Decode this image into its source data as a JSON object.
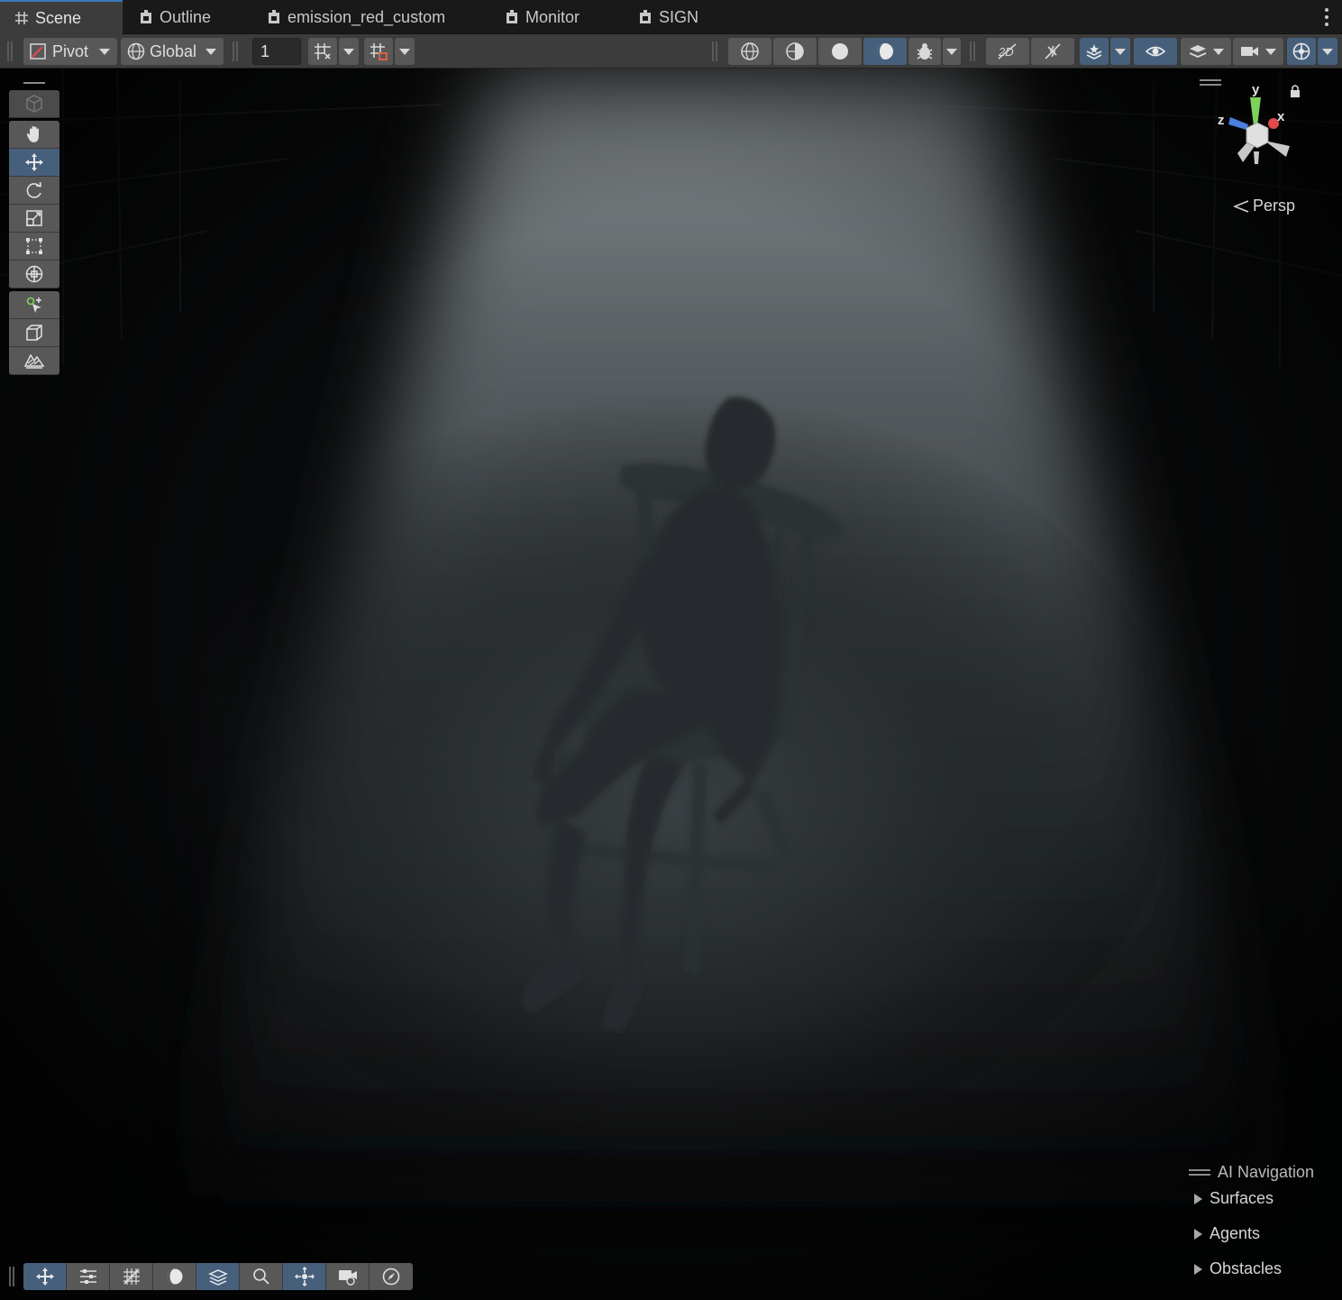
{
  "tabs": [
    {
      "label": "Scene",
      "icon": "grid-hash-icon",
      "active": true
    },
    {
      "label": "Outline",
      "icon": "prefab-icon",
      "active": false
    },
    {
      "label": "emission_red_custom",
      "icon": "prefab-icon",
      "active": false
    },
    {
      "label": "Monitor",
      "icon": "prefab-icon",
      "active": false
    },
    {
      "label": "SIGN",
      "icon": "prefab-icon",
      "active": false
    }
  ],
  "toolbar": {
    "pivot_label": "Pivot",
    "global_label": "Global",
    "grid_size_value": "1"
  },
  "gizmo": {
    "axis_y": "y",
    "axis_x": "x",
    "axis_z": "z",
    "projection_label": "Persp"
  },
  "ai_navigation": {
    "title": "AI Navigation",
    "items": [
      "Surfaces",
      "Agents",
      "Obstacles"
    ]
  },
  "colors": {
    "active_accent": "#46607c",
    "button_bg": "#585858",
    "toolbar_bg": "#3c3c3c",
    "axis_x": "#e04a4a",
    "axis_y": "#7cd35a",
    "axis_z": "#4a7fe0"
  }
}
